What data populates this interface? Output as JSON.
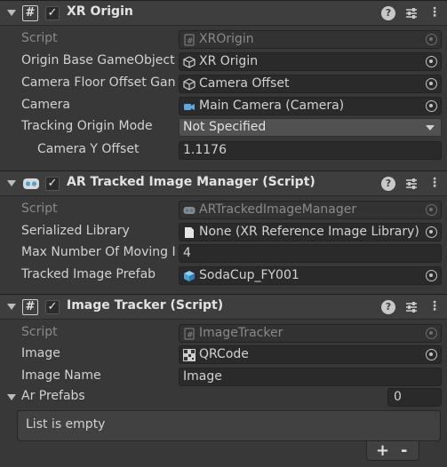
{
  "components": [
    {
      "title": "XR Origin",
      "enabled": true,
      "fields": {
        "script": {
          "label": "Script",
          "value": "XROrigin"
        },
        "origin_base": {
          "label": "Origin Base GameObject",
          "value": "XR Origin"
        },
        "camera_floor_offset": {
          "label": "Camera Floor Offset Gan",
          "value": "Camera Offset"
        },
        "camera": {
          "label": "Camera",
          "value": "Main Camera (Camera)"
        },
        "tracking_mode": {
          "label": "Tracking Origin Mode",
          "value": "Not Specified"
        },
        "camera_y_offset": {
          "label": "Camera Y Offset",
          "value": "1.1176"
        }
      }
    },
    {
      "title": "AR Tracked Image Manager (Script)",
      "enabled": true,
      "fields": {
        "script": {
          "label": "Script",
          "value": "ARTrackedImageManager"
        },
        "serialized_library": {
          "label": "Serialized Library",
          "value": "None (XR Reference Image Library)"
        },
        "max_moving": {
          "label": "Max Number Of Moving I",
          "value": "4"
        },
        "prefab": {
          "label": "Tracked Image Prefab",
          "value": "SodaCup_FY001"
        }
      }
    },
    {
      "title": "Image Tracker (Script)",
      "enabled": true,
      "fields": {
        "script": {
          "label": "Script",
          "value": "ImageTracker"
        },
        "image": {
          "label": "Image",
          "value": "QRCode"
        },
        "image_name": {
          "label": "Image Name",
          "value": "Image"
        },
        "ar_prefabs": {
          "label": "Ar Prefabs",
          "size": "0",
          "empty_text": "List is empty",
          "add": "+",
          "remove": "-"
        }
      }
    }
  ],
  "header_buttons": {
    "help": "?",
    "more": "⋮"
  }
}
